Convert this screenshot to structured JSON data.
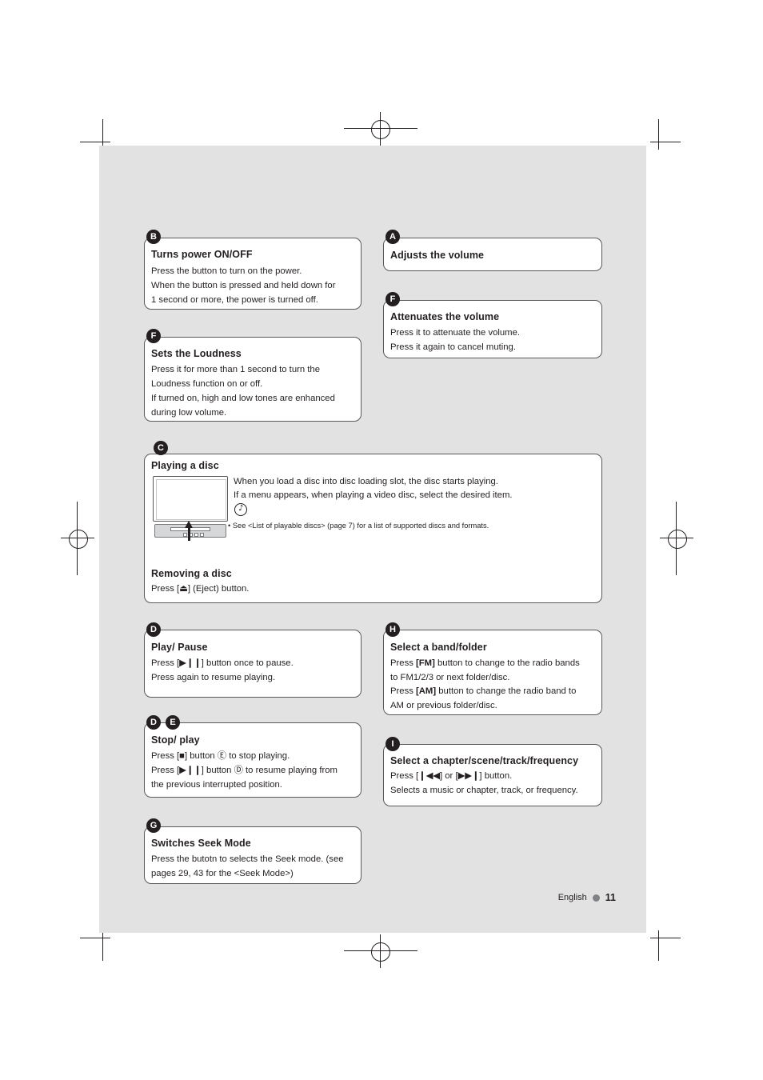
{
  "footer": {
    "language": "English",
    "page": "11"
  },
  "blocks": [
    {
      "id": "turns-power",
      "badges": [
        "B"
      ],
      "title": "Turns power ON/OFF",
      "lines": [
        "Press the button to turn on the power.",
        "When the button is pressed and held down for",
        "1 second or more, the power is turned off."
      ]
    },
    {
      "id": "sets-loudness",
      "badges": [
        "F"
      ],
      "title": "Sets the Loudness",
      "lines": [
        "Press it for more than 1 second to turn the",
        "Loudness function on or off.",
        "If turned on, high and low tones are enhanced",
        "during low volume."
      ]
    },
    {
      "id": "adjusts-volume",
      "badges": [
        "A"
      ],
      "title": "Adjusts the volume",
      "lines": []
    },
    {
      "id": "attenuates-volume",
      "badges": [
        "F"
      ],
      "title": "Attenuates the volume",
      "lines": [
        "Press it to attenuate the volume.",
        "Press it again to cancel muting."
      ]
    },
    {
      "id": "playing-disc",
      "badges": [
        "C"
      ],
      "title": "Playing a disc",
      "lines": [
        "When you load a disc into disc loading slot, the disc starts playing.",
        "If a menu appears, when playing a video disc, select the desired item."
      ],
      "note": "• See <List of playable discs> (page 7) for a list of supported discs and formats.",
      "subtitle": "Removing a disc",
      "sublines": [
        "Press [⏏] (Eject) button."
      ]
    },
    {
      "id": "play-pause",
      "badges": [
        "D"
      ],
      "title": "Play/ Pause",
      "lines": [
        "Press [▶❙❙] button once to pause.",
        "Press again to resume playing."
      ]
    },
    {
      "id": "stop-play",
      "badges": [
        "D",
        "E"
      ],
      "title": "Stop/ play",
      "lines": [
        "Press [■] button Ⓔ to stop playing.",
        "Press [▶❙❙] button Ⓓ to resume playing from",
        "the previous interrupted position."
      ]
    },
    {
      "id": "switches-seek",
      "badges": [
        "G"
      ],
      "title": "Switches Seek Mode",
      "lines": [
        "Press the butotn to selects the Seek mode. (see",
        "pages 29, 43 for the <Seek Mode>)"
      ]
    },
    {
      "id": "select-band",
      "badges": [
        "H"
      ],
      "title": "Select a band/folder",
      "lines": [
        "Press [FM] button to change to the radio bands",
        "to FM1/2/3 or next folder/disc.",
        "Press [AM] button to change the radio band to",
        "AM or previous folder/disc."
      ]
    },
    {
      "id": "select-chapter",
      "badges": [
        "I"
      ],
      "title": "Select a chapter/scene/track/frequency",
      "lines": [
        "Press [❙◀◀] or [▶▶❙] button.",
        "Selects a music or chapter, track, or frequency."
      ]
    }
  ],
  "disc_note_icon": "note-icon"
}
